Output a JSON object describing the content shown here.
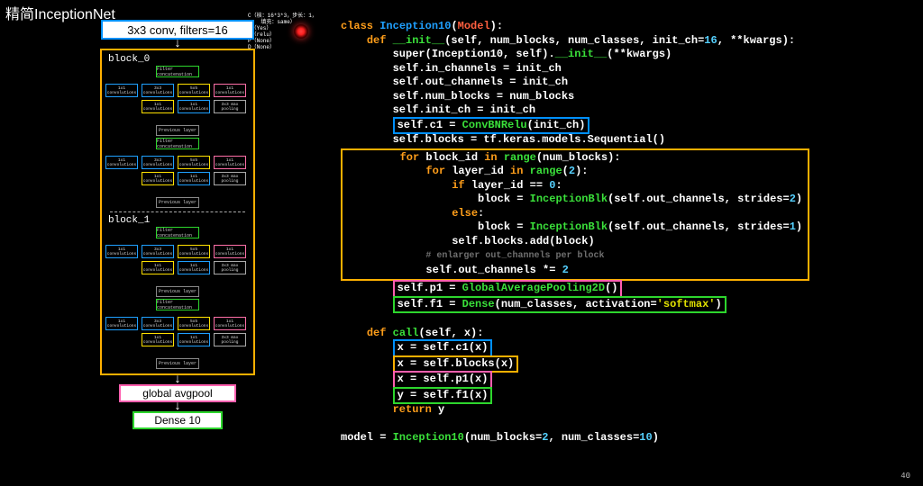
{
  "title": "精简InceptionNet",
  "page_num": "40",
  "legend": {
    "c": "C（核：16*3*3，步长：1，",
    "pad": "填充：same）",
    "b": "B（Yes）",
    "a": "A（relu）",
    "p": "P（None）",
    "d": "D（None）"
  },
  "diagram": {
    "conv_label": "3x3  conv, filters=16",
    "block0": "block_0",
    "block1": "block_1",
    "filter_concat": "Filter concatenation",
    "prev_layer": "Previous layer",
    "cell_1x1": "1x1 convolutions",
    "cell_3x3": "3x3 convolutions",
    "cell_5x5": "5x5 convolutions",
    "cell_pool": "3x3 max pooling",
    "global_pool": "global avgpool",
    "dense": "Dense 10"
  },
  "code": {
    "class_kw": "class",
    "classname": "Inception10",
    "model": "Model",
    "def_kw": "def",
    "init": "__init__",
    "sig_init": "(self, num_blocks, num_classes, init_ch=",
    "sixteen": "16",
    "kwargs": ", **kwargs):",
    "super": "super(Inception10, self).",
    "init2": "__init__",
    "super_end": "(**kwargs)",
    "l4": "self.in_channels = init_ch",
    "l5": "self.out_channels = init_ch",
    "l6": "self.num_blocks = num_blocks",
    "l7": "self.init_ch = init_ch",
    "l8_pre": "self.c1 = ",
    "l8_fn": "ConvBNRelu",
    "l8_post": "(init_ch)",
    "l9": "self.blocks = tf.keras.models.Sequential()",
    "for_kw": "for",
    "in_kw": "in",
    "range_fn": "range",
    "loop1_a": " block_id ",
    "loop1_b": "(num_blocks):",
    "loop2_a": " layer_id ",
    "loop2_b": "(",
    "two": "2",
    "close_colon": "):",
    "if_kw": "if",
    "ifcond": " layer_id == ",
    "zero": "0",
    "colon": ":",
    "else_kw": "else",
    "assign_block": "block = ",
    "inceptionblk": "InceptionBlk",
    "blkargs1": "(self.out_channels, strides=",
    "one": "1",
    "close_paren": ")",
    "addline": "self.blocks.add(block)",
    "cmt": "# enlarger out_channels per block",
    "mult": "self.out_channels *= ",
    "p1_pre": "self.p1 = ",
    "p1_fn": "GlobalAveragePooling2D",
    "p1_post": "()",
    "f1_pre": "self.f1 = ",
    "f1_fn": "Dense",
    "f1_mid": "(num_classes, activation=",
    "softmax": "'softmax'",
    "call": "call",
    "call_sig": "(self, x):",
    "c1": "x = self.c1(x)",
    "c2": "x = self.blocks(x)",
    "c3": "x = self.p1(x)",
    "c4": "y = self.f1(x)",
    "return_kw": "return",
    "ret_val": " y",
    "model_line_a": "model = ",
    "model_line_b": "Inception10",
    "model_line_c": "(num_blocks=",
    "model_line_d": ", num_classes=",
    "ten": "10"
  }
}
